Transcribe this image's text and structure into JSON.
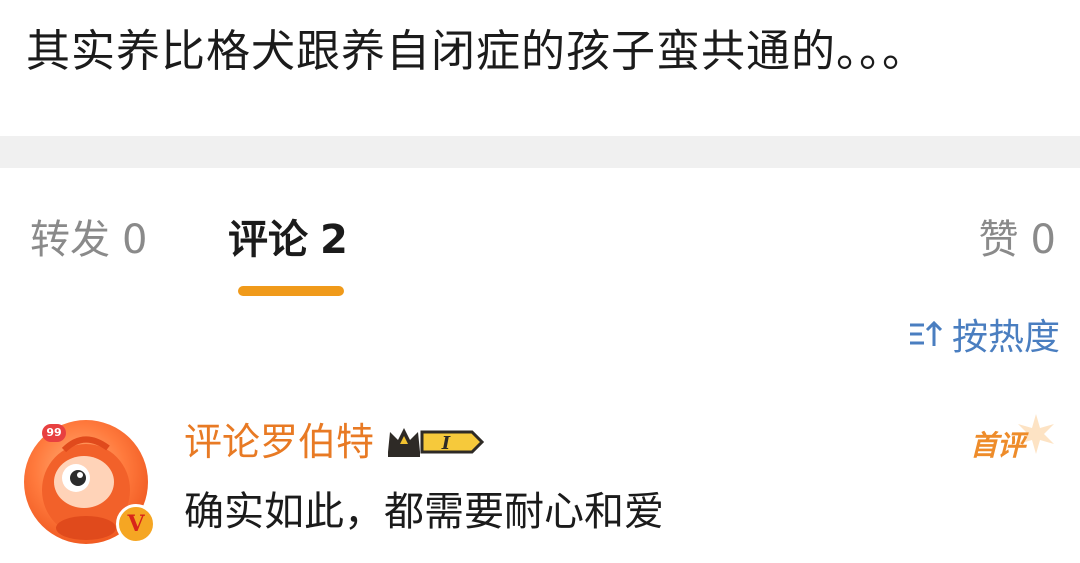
{
  "post": {
    "text": "其实养比格犬跟养自闭症的孩子蛮共通的。。。"
  },
  "tabs": {
    "repost": {
      "label": "转发",
      "count": "0"
    },
    "comments": {
      "label": "评论",
      "count": "2"
    },
    "likes": {
      "label": "赞",
      "count": "0"
    }
  },
  "sort": {
    "icon": "sort-icon",
    "label": "按热度"
  },
  "comment": {
    "avatar_badge": "99",
    "verified_badge": "V",
    "username": "评论罗伯特",
    "vip_level": "I",
    "first_label": "首评",
    "text": "确实如此，都需要耐心和爱"
  },
  "colors": {
    "accent_orange": "#f09a1a",
    "username_orange": "#e87a24",
    "sort_blue": "#4a7ec0",
    "text_dark": "#1b1b1b",
    "text_gray": "#8a8a8a",
    "divider_gray": "#f0f0f0"
  }
}
